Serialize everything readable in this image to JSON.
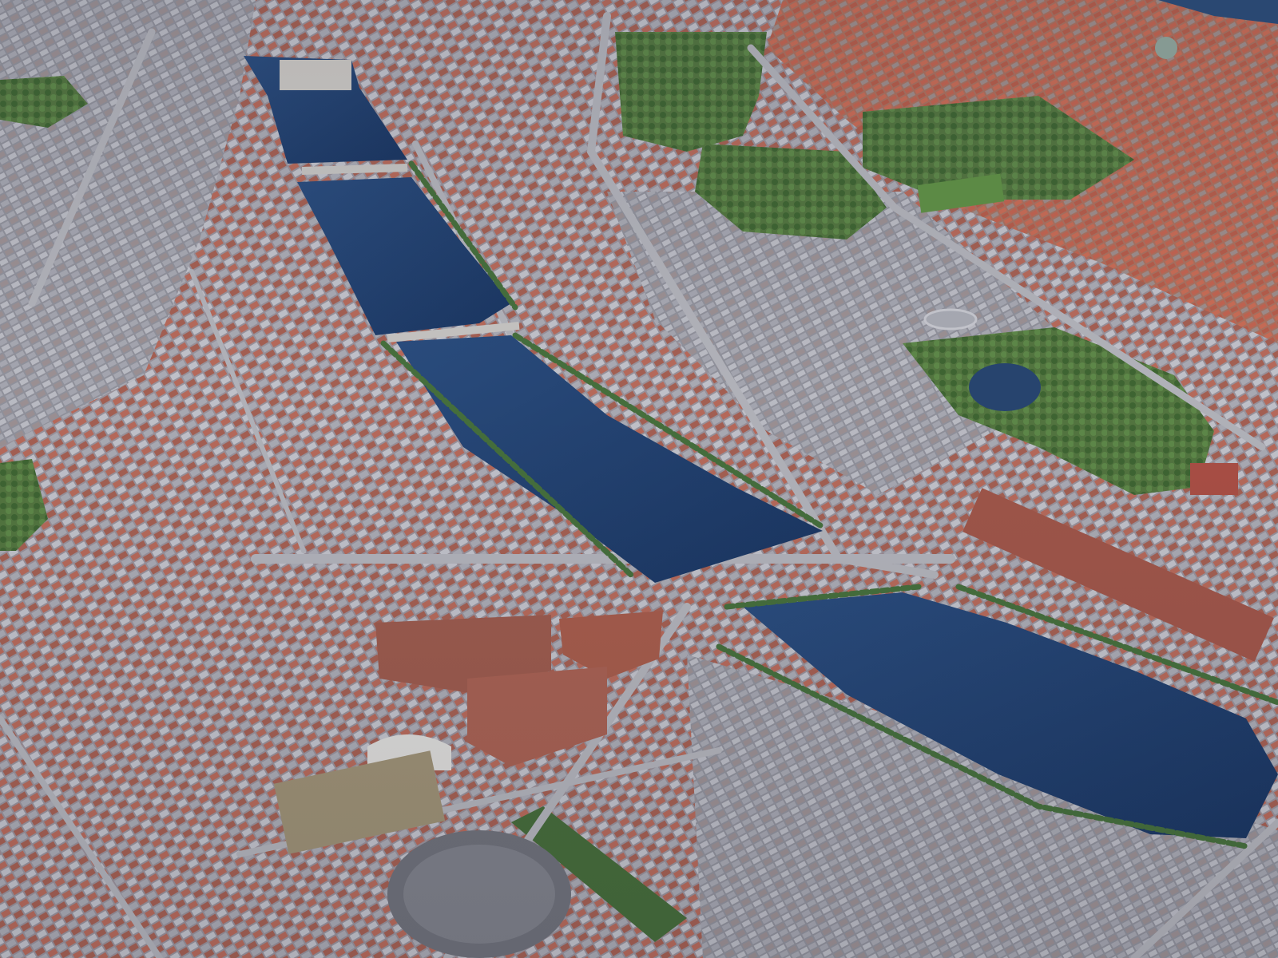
{
  "scene": {
    "kind": "aerial-3d-city-view",
    "labels": []
  },
  "palette": {
    "water": "#1f3d6b",
    "water_light": "#2f5a8f",
    "roof_red": "#b9614f",
    "roof_grey": "#9a9ba6",
    "roof_light": "#c2c3cb",
    "park_green": "#4e7a3f",
    "tree_green": "#3f6a34",
    "road": "#a8a9b0",
    "ground": "#8d8f98"
  }
}
